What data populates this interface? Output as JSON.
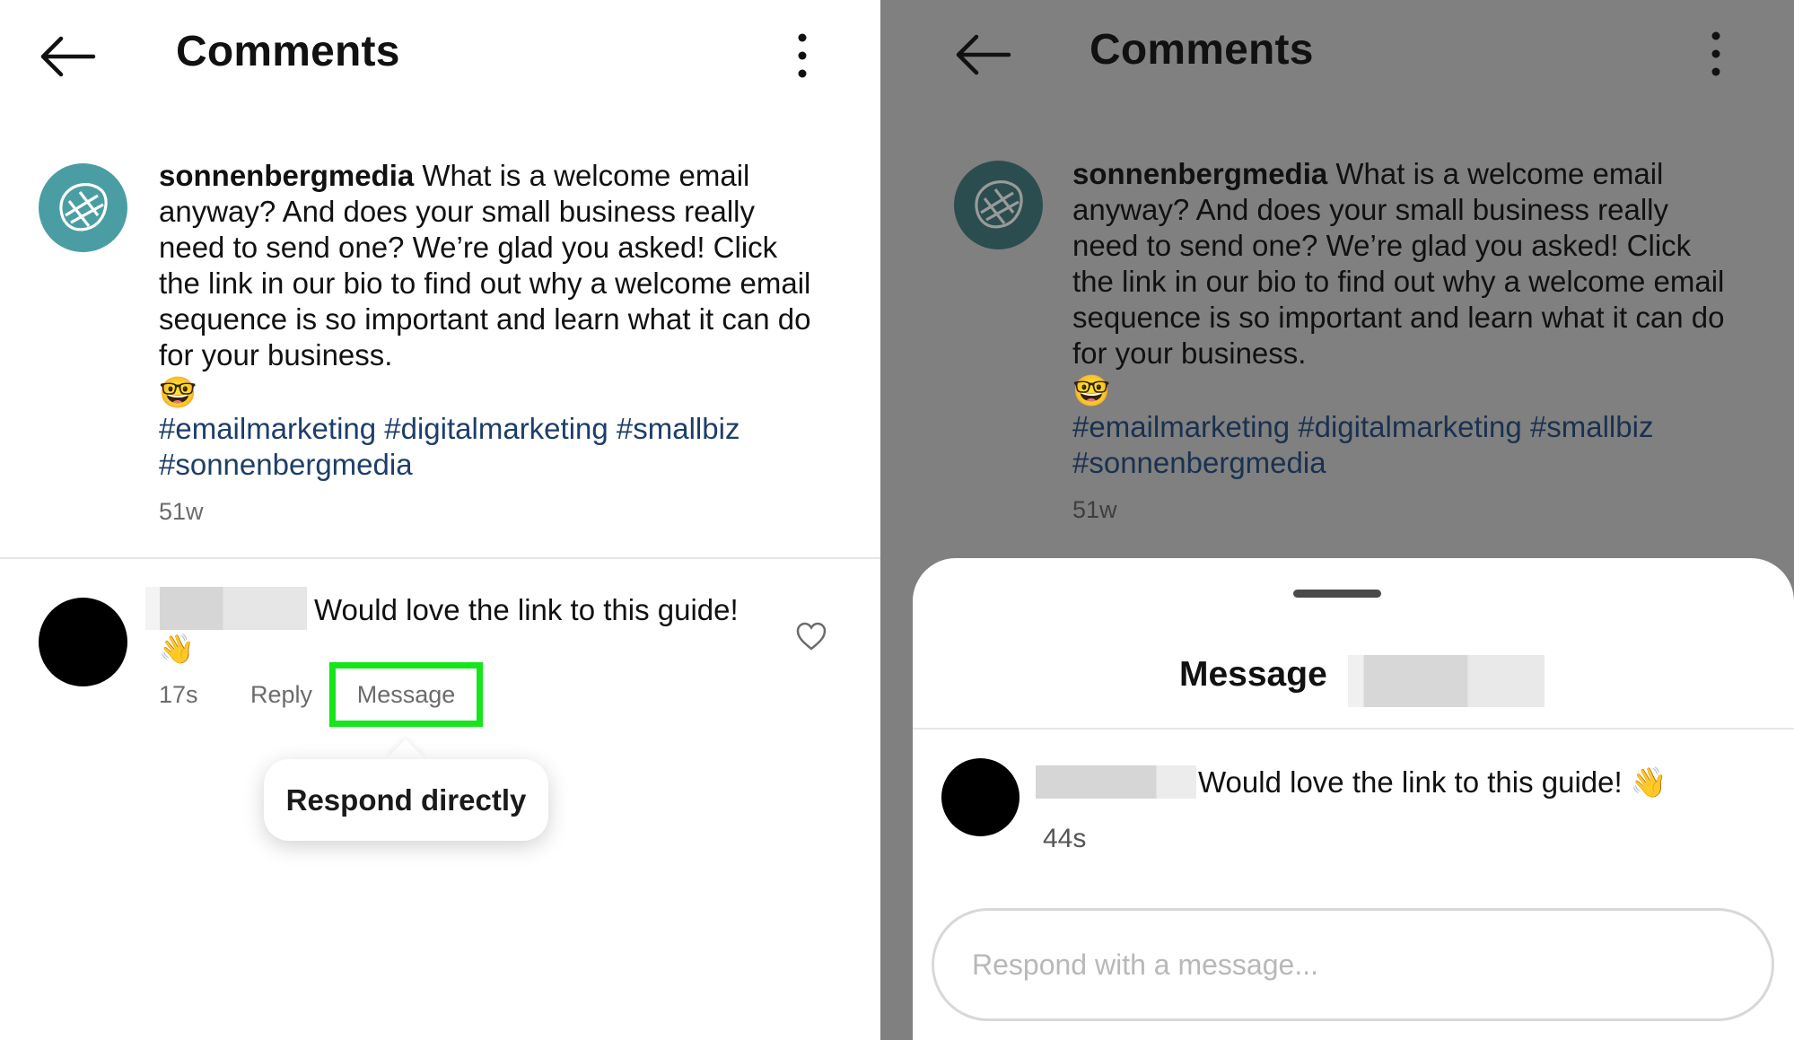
{
  "left": {
    "header": {
      "title": "Comments"
    },
    "post": {
      "username": "sonnenbergmedia",
      "caption": "What is a welcome email anyway? And does your small business really need to send one? We’re glad you asked! Click the link in our bio to find out why a welcome email sequence is so important and learn what it can do for your business.",
      "emoji": "🤓",
      "hashtags": " #emailmarketing #digitalmarketing #smallbiz #sonnenbergmedia",
      "age": "51w"
    },
    "comment": {
      "text": "Would love the link to this guide!",
      "emoji": "👋",
      "age": "17s",
      "reply_label": "Reply",
      "message_label": "Message"
    },
    "tooltip": {
      "text": "Respond directly"
    },
    "highlight_color": "#15e51a"
  },
  "right": {
    "header": {
      "title": "Comments"
    },
    "post": {
      "username": "sonnenbergmedia",
      "caption": "What is a welcome email anyway? And does your small business really need to send one? We’re glad you asked! Click the link in our bio to find out why a welcome email sequence is so important and learn what it can do for your business.",
      "emoji": "🤓",
      "hashtags": " #emailmarketing #digitalmarketing #smallbiz #sonnenbergmedia",
      "age": "51w"
    },
    "sheet": {
      "title": "Message",
      "comment_text": "Would love the link to this guide! 👋",
      "comment_age": "44s",
      "input_placeholder": "Respond with a message..."
    }
  }
}
